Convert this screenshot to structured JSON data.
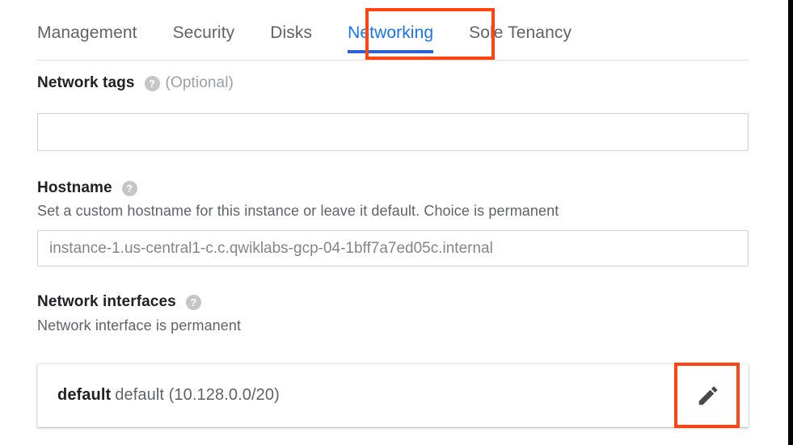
{
  "tabs": [
    {
      "label": "Management",
      "active": false
    },
    {
      "label": "Security",
      "active": false
    },
    {
      "label": "Disks",
      "active": false
    },
    {
      "label": "Networking",
      "active": true
    },
    {
      "label": "Sole Tenancy",
      "active": false
    }
  ],
  "sections": {
    "network_tags": {
      "title": "Network tags",
      "optional_label": "(Optional)",
      "help_icon": "help-icon",
      "input_value": "",
      "input_placeholder": ""
    },
    "hostname": {
      "title": "Hostname",
      "help_icon": "help-icon",
      "description": "Set a custom hostname for this instance or leave it default. Choice is permanent",
      "input_value": "",
      "input_placeholder": "instance-1.us-central1-c.c.qwiklabs-gcp-04-1bff7a7ed05c.internal"
    },
    "network_interfaces": {
      "title": "Network interfaces",
      "help_icon": "help-icon",
      "description": "Network interface is permanent",
      "interface": {
        "name": "default",
        "detail": "default (10.128.0.0/20)",
        "edit_icon": "pencil-icon"
      }
    }
  },
  "highlights": {
    "color": "#ff4612",
    "targets": [
      "networking-tab",
      "network-interface-edit-button"
    ]
  },
  "colors": {
    "active_tab_text": "#1a73e8",
    "active_tab_underline": "#2e62d3",
    "inactive_tab_text": "#5f6368",
    "heading_text": "#202124",
    "muted_text": "#5f6368",
    "placeholder_text": "#80868b",
    "border": "#cfd2d5",
    "highlight": "#ff4612"
  }
}
